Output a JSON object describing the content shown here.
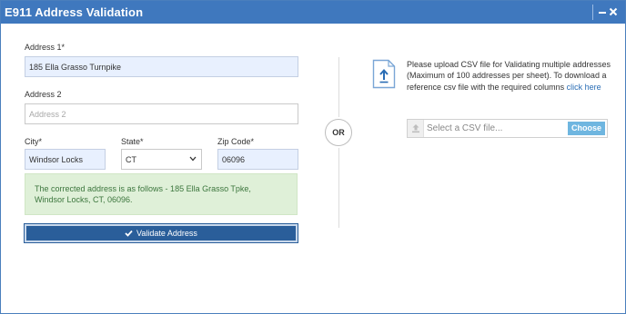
{
  "window": {
    "title": "E911 Address Validation"
  },
  "form": {
    "address1": {
      "label": "Address 1*",
      "value": "185 Ella Grasso Turnpike"
    },
    "address2": {
      "label": "Address 2",
      "placeholder": "Address 2"
    },
    "city": {
      "label": "City*",
      "value": "Windsor Locks"
    },
    "state": {
      "label": "State*",
      "value": "CT"
    },
    "zip": {
      "label": "Zip Code*",
      "value": "06096"
    }
  },
  "alert": {
    "line1": "The corrected address is as follows - 185 Ella Grasso Tpke,",
    "line2": "Windsor Locks, CT, 06096."
  },
  "validate_button": {
    "label": "Validate Address"
  },
  "divider": {
    "label": "OR"
  },
  "upload": {
    "text": "Please upload CSV file for Validating multiple addresses (Maximum of 100 addresses per sheet). To download a reference csv file with the required columns",
    "link": "click here",
    "placeholder": "Select a CSV file...",
    "choose_label": "Choose"
  },
  "colors": {
    "titlebar": "#3f78be",
    "primary_button": "#2a5e9a",
    "success_bg": "#dff0d8",
    "success_text": "#3c763d",
    "link": "#2a6db5",
    "choose_button": "#6fb6e0"
  },
  "icons": [
    "minimize-icon",
    "close-icon",
    "chevron-down-icon",
    "check-icon",
    "upload-file-icon",
    "upload-icon"
  ]
}
